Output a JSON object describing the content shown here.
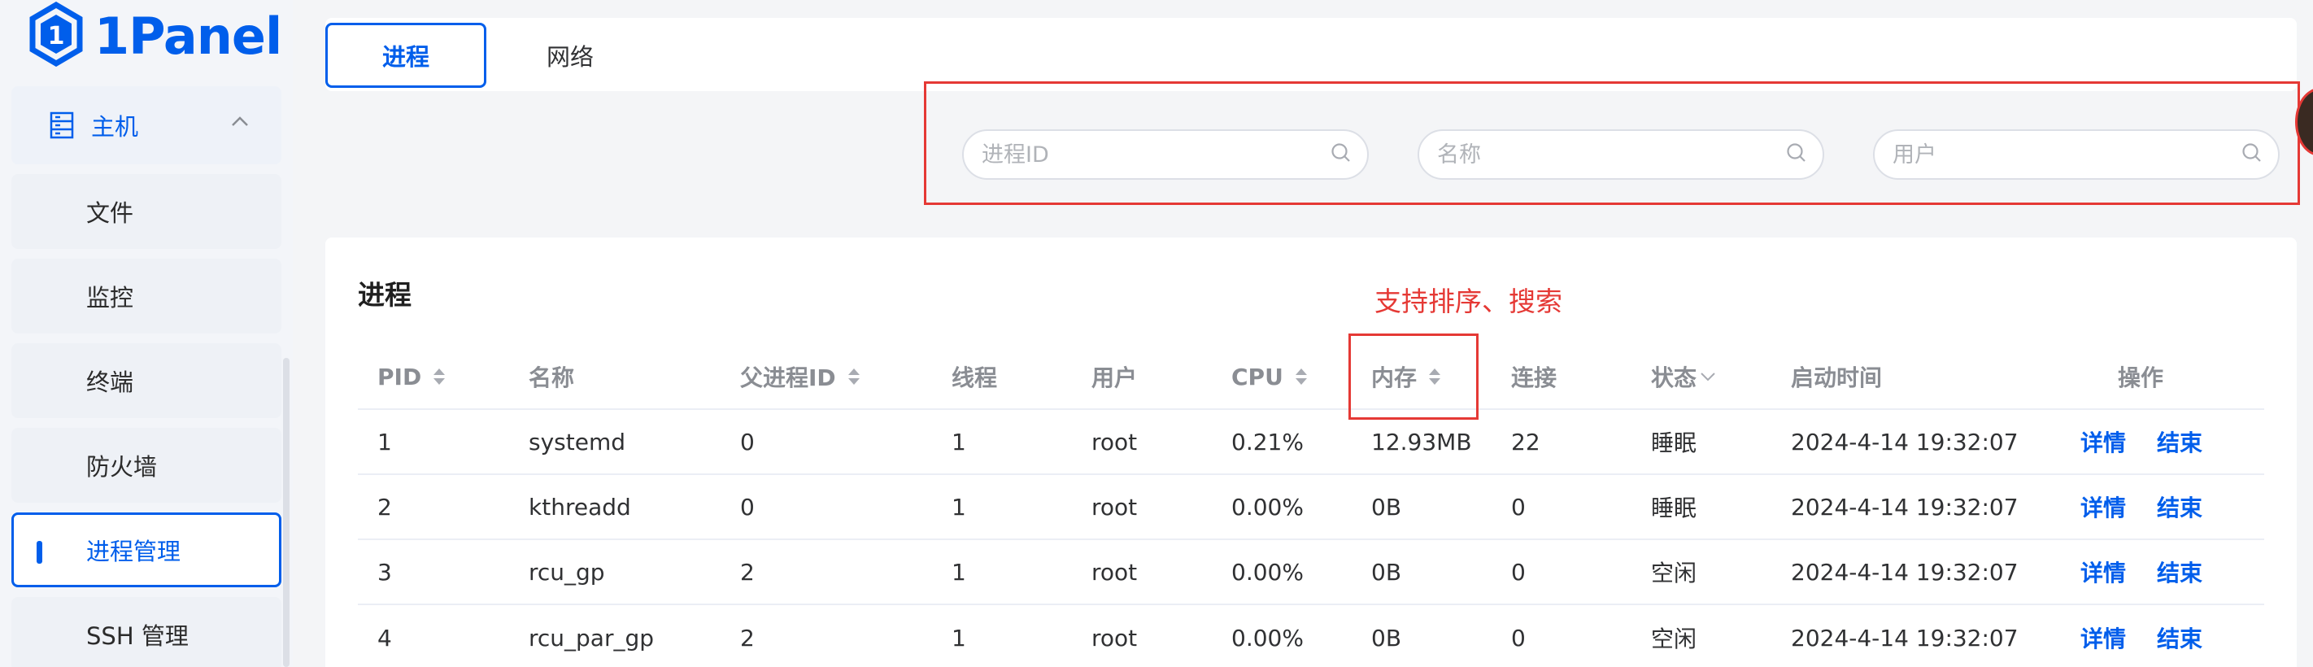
{
  "app": {
    "logo_text": "1Panel"
  },
  "sidebar": {
    "group": {
      "label": "主机",
      "expanded": true
    },
    "items": [
      {
        "label": "文件"
      },
      {
        "label": "监控"
      },
      {
        "label": "终端"
      },
      {
        "label": "防火墙"
      },
      {
        "label": "进程管理",
        "active": true
      },
      {
        "label": "SSH 管理"
      }
    ]
  },
  "tabs": [
    {
      "label": "进程",
      "active": true
    },
    {
      "label": "网络"
    }
  ],
  "search": {
    "pid_placeholder": "进程ID",
    "name_placeholder": "名称",
    "user_placeholder": "用户"
  },
  "card": {
    "title": "进程",
    "annotation": "支持排序、搜索"
  },
  "table": {
    "columns": [
      "PID",
      "名称",
      "父进程ID",
      "线程",
      "用户",
      "CPU",
      "内存",
      "连接",
      "状态",
      "启动时间",
      "操作"
    ],
    "action_labels": {
      "detail": "详情",
      "end": "结束"
    },
    "rows": [
      {
        "pid": "1",
        "name": "systemd",
        "ppid": "0",
        "threads": "1",
        "user": "root",
        "cpu": "0.21%",
        "mem": "12.93MB",
        "conn": "22",
        "status": "睡眠",
        "start": "2024-4-14 19:32:07"
      },
      {
        "pid": "2",
        "name": "kthreadd",
        "ppid": "0",
        "threads": "1",
        "user": "root",
        "cpu": "0.00%",
        "mem": "0B",
        "conn": "0",
        "status": "睡眠",
        "start": "2024-4-14 19:32:07"
      },
      {
        "pid": "3",
        "name": "rcu_gp",
        "ppid": "2",
        "threads": "1",
        "user": "root",
        "cpu": "0.00%",
        "mem": "0B",
        "conn": "0",
        "status": "空闲",
        "start": "2024-4-14 19:32:07"
      },
      {
        "pid": "4",
        "name": "rcu_par_gp",
        "ppid": "2",
        "threads": "1",
        "user": "root",
        "cpu": "0.00%",
        "mem": "0B",
        "conn": "0",
        "status": "空闲",
        "start": "2024-4-14 19:32:07"
      }
    ]
  },
  "colors": {
    "accent": "#005eeb",
    "annotation": "#e53935"
  }
}
